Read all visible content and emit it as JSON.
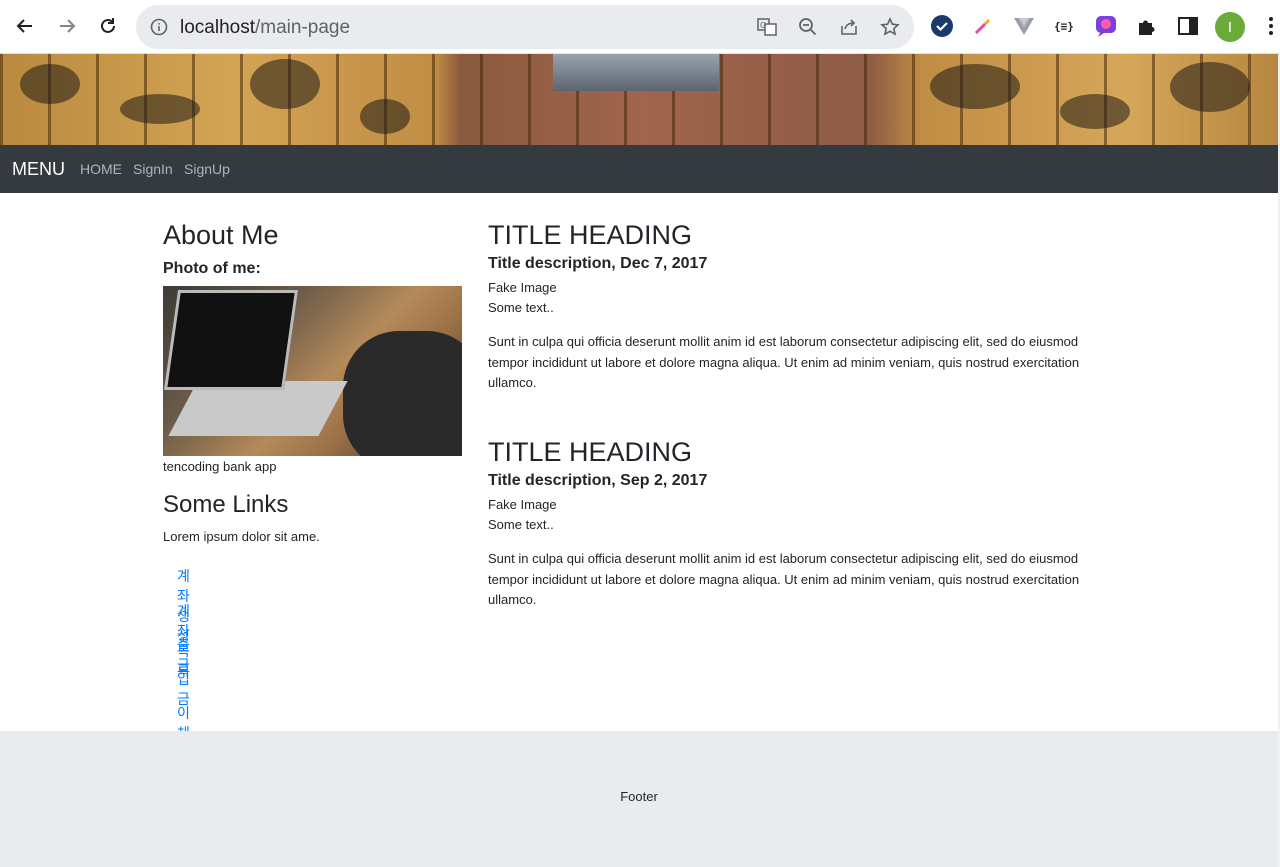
{
  "browser": {
    "url_host": "localhost",
    "url_path": "/main-page",
    "avatar_letter": "I"
  },
  "navbar": {
    "brand": "MENU",
    "links": [
      "HOME",
      "SignIn",
      "SignUp"
    ]
  },
  "sidebar": {
    "about_heading": "About Me",
    "photo_label": "Photo of me:",
    "photo_caption": "tencoding bank app",
    "links_heading": "Some Links",
    "links_text": "Lorem ipsum dolor sit ame.",
    "links": [
      "계좌생성",
      "계좌목록",
      "출금",
      "입금",
      "이체"
    ]
  },
  "posts": [
    {
      "title": "TITLE HEADING",
      "description": "Title description, Dec 7, 2017",
      "image_text": "Fake Image",
      "text": "Some text..",
      "body": "Sunt in culpa qui officia deserunt mollit anim id est laborum consectetur adipiscing elit, sed do eiusmod tempor incididunt ut labore et dolore magna aliqua. Ut enim ad minim veniam, quis nostrud exercitation ullamco."
    },
    {
      "title": "TITLE HEADING",
      "description": "Title description, Sep 2, 2017",
      "image_text": "Fake Image",
      "text": "Some text..",
      "body": "Sunt in culpa qui officia deserunt mollit anim id est laborum consectetur adipiscing elit, sed do eiusmod tempor incididunt ut labore et dolore magna aliqua. Ut enim ad minim veniam, quis nostrud exercitation ullamco."
    }
  ],
  "footer": {
    "text": "Footer"
  },
  "colors": {
    "navbar_bg": "#343a40",
    "link": "#007bff",
    "footer_bg": "#e9ecef"
  }
}
